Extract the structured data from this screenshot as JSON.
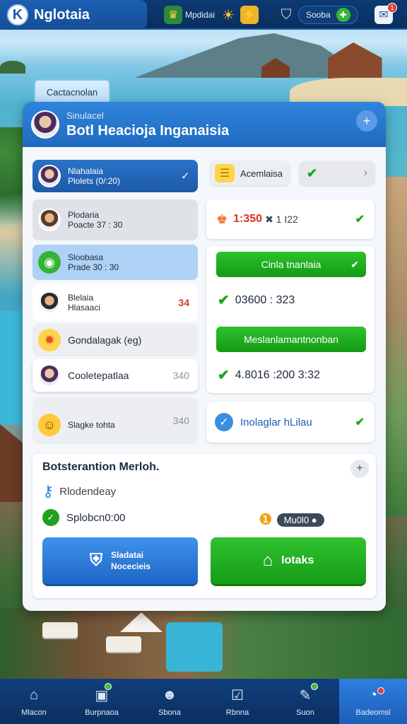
{
  "app": {
    "title": "Nglotaia",
    "logo_letter": "K"
  },
  "topbar": {
    "item1_label": "Mpdidai",
    "item2_label": "Sooba",
    "notification_count": "1"
  },
  "back_tab": {
    "label": "Cactacnolan"
  },
  "card": {
    "subtitle": "Sinulacel",
    "title": "Botl Heacioja Inganaisia",
    "head_button": "+"
  },
  "list": [
    {
      "title": "Nlahalaia",
      "subtitle": "Plolets (0/:20)",
      "right": "✓"
    },
    {
      "title": "Plodaria",
      "subtitle": "Poacte 37 : 30",
      "right": ""
    },
    {
      "title": "Sloobasa",
      "subtitle": "Prade 30 : 30",
      "right": ""
    },
    {
      "title": "Blelaia",
      "subtitle": "Hlasaaci",
      "right": "34"
    },
    {
      "title": "Gondalagak (eg)",
      "subtitle": "",
      "right": ""
    },
    {
      "title": "Cooletepatlaa",
      "subtitle": "",
      "right": "340"
    },
    {
      "title": "Slagke tohta",
      "subtitle": "",
      "right": "340"
    }
  ],
  "right": {
    "chip_label": "Acemlaisa",
    "score_text": "1:350",
    "score_suffix": "✖ 1 I22",
    "green_btn1": "Cinla tnanlaia",
    "line1": "03600 : 323",
    "green_btn2": "Meslanlamantnonban",
    "line2": "4.8016 :200 3:32",
    "info_label": "Inolaglar hLilau"
  },
  "panel": {
    "title": "Botsterantion Merloh.",
    "row1": "Rlodendeay",
    "row2": "Splobcn0:00",
    "badge": "Mu0l0 ●",
    "btn_blue_line1": "Sladatai",
    "btn_blue_line2": "Nocecieis",
    "btn_green": "Iotaks",
    "plus": "+"
  },
  "nav": [
    {
      "label": "Mlacon"
    },
    {
      "label": "Burpnaoa"
    },
    {
      "label": "Sbona"
    },
    {
      "label": "Rbnna"
    },
    {
      "label": "Suon"
    },
    {
      "label": "Badeomsl"
    }
  ],
  "colors": {
    "primary": "#1f6ac0",
    "green": "#149a14",
    "nav": "#0b2f61"
  }
}
